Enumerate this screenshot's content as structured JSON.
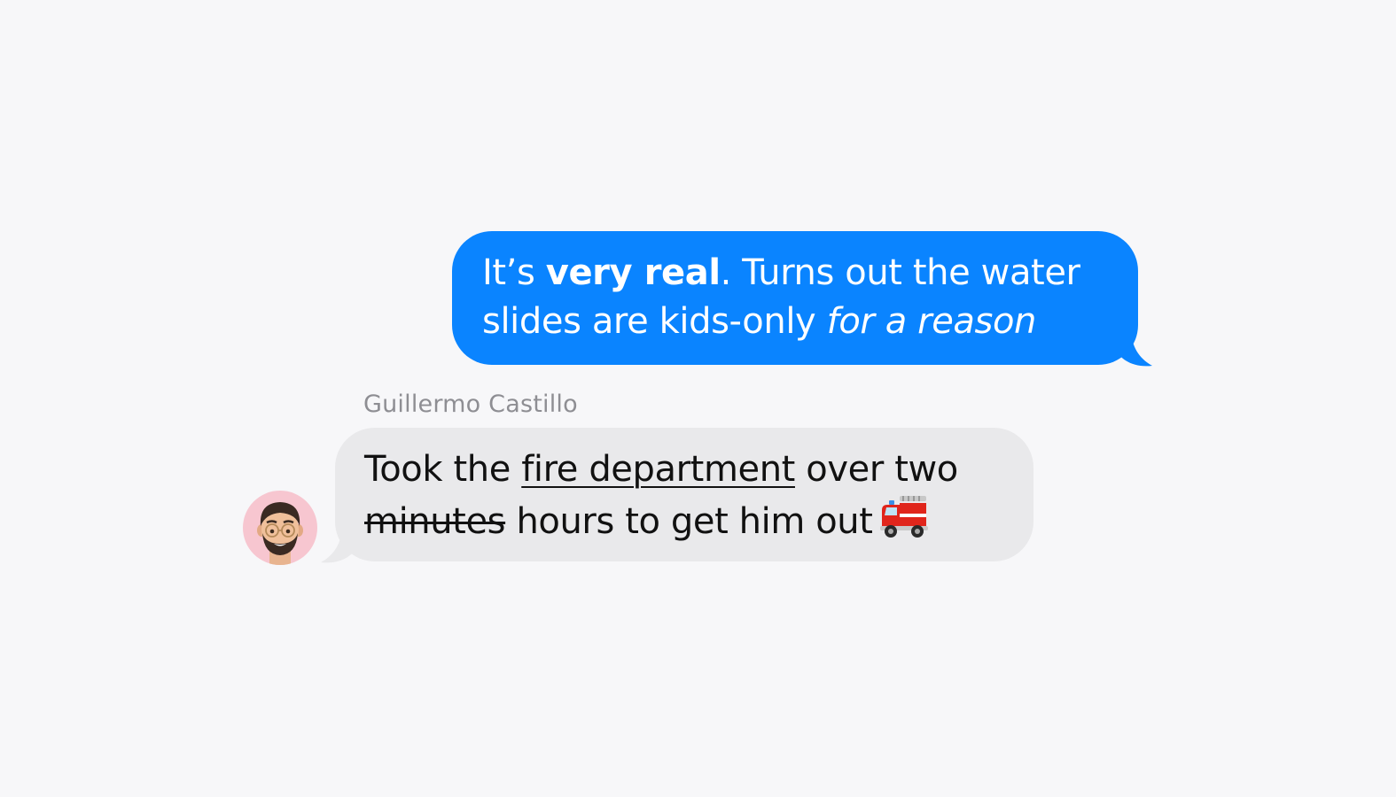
{
  "outgoing_message": {
    "prefix": "It’s ",
    "bold": "very real",
    "middle": ". Turns out the water",
    "line2_start": "slides are kids-only ",
    "italic": "for a reason",
    "bubble_color": "#0a84ff"
  },
  "incoming_message": {
    "sender": "Guillermo Castillo",
    "line1_start": "Took the ",
    "underlined": "fire department",
    "line1_end": " over two",
    "strikethrough": "minutes",
    "line2_end": " hours to get him out",
    "emoji": "fire-engine-icon",
    "bubble_color": "#e9e9eb"
  },
  "avatar": {
    "icon": "memoji-avatar-icon",
    "background": "#f7c6d0"
  }
}
